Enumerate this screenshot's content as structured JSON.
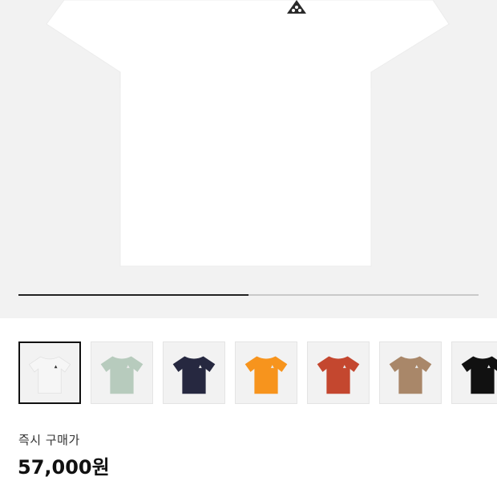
{
  "product": {
    "progress": 0.5,
    "variants": [
      {
        "color": "#f6f6f6",
        "selected": true
      },
      {
        "color": "#b7cbbd",
        "selected": false
      },
      {
        "color": "#262840",
        "selected": false
      },
      {
        "color": "#f7941d",
        "selected": false
      },
      {
        "color": "#c4472f",
        "selected": false
      },
      {
        "color": "#a98769",
        "selected": false
      },
      {
        "color": "#111111",
        "selected": false
      }
    ]
  },
  "purchase": {
    "label": "즉시 구매가",
    "price": "57,000원"
  }
}
